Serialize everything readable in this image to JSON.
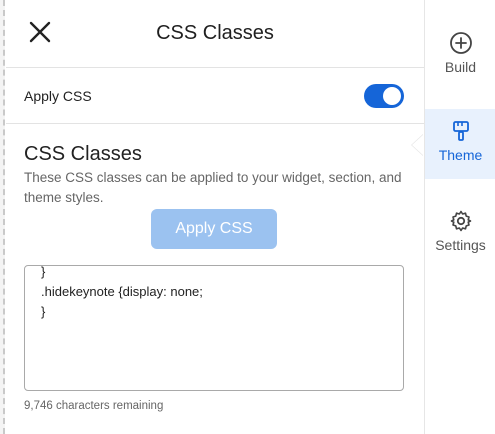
{
  "header": {
    "title": "CSS Classes"
  },
  "apply_css": {
    "label": "Apply CSS",
    "enabled": true
  },
  "section": {
    "heading": "CSS Classes",
    "description": "These CSS classes can be applied to your widget, section, and theme styles.",
    "button_label": "Apply CSS"
  },
  "editor": {
    "content": "}\n.hidekeynote {display: none;\n}",
    "chars_remaining": "9,746 characters remaining"
  },
  "rail": {
    "items": [
      {
        "label": "Build",
        "icon": "plus-circle-icon"
      },
      {
        "label": "Theme",
        "icon": "paint-roller-icon",
        "active": true
      },
      {
        "label": "Settings",
        "icon": "gear-icon"
      }
    ]
  },
  "colors": {
    "accent": "#1565d8",
    "button_disabled": "#9bc2f0",
    "active_bg": "#e8f1fd"
  }
}
